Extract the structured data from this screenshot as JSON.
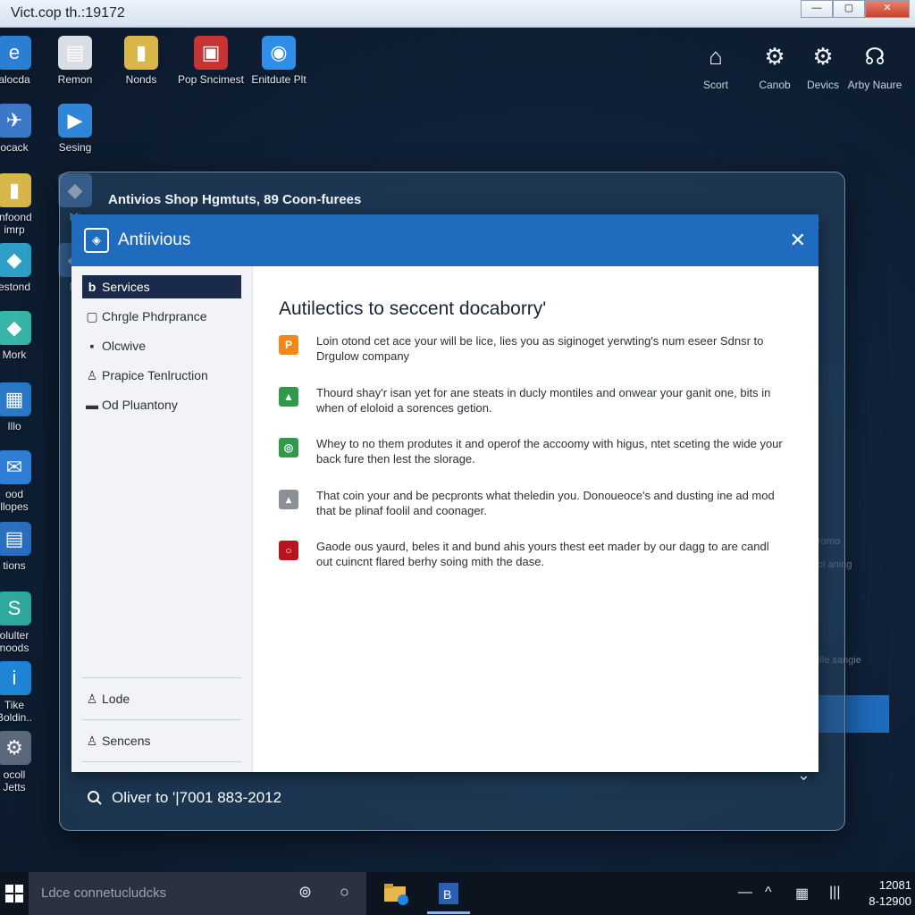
{
  "outer_window": {
    "title": "Vict.cop th.:19172",
    "min_label": "—",
    "max_label": "▢",
    "close_label": "✕"
  },
  "desktop_icons": [
    {
      "label": "alocda",
      "icon": "edge-browser-icon",
      "glyph": "e",
      "color": "#2a7fd4"
    },
    {
      "label": "Remon",
      "icon": "control-panel-icon",
      "glyph": "▤",
      "color": "#d9dde4"
    },
    {
      "label": "Nonds",
      "icon": "folder-icon",
      "glyph": "▮",
      "color": "#d9b64a"
    },
    {
      "label": "Pop Sncimest",
      "icon": "presentation-icon",
      "glyph": "▣",
      "color": "#c83434"
    },
    {
      "label": "Enitdute Plt",
      "icon": "chat-icon",
      "glyph": "◉",
      "color": "#2f8ee6"
    },
    {
      "label": "ocack",
      "icon": "network-icon",
      "glyph": "✈",
      "color": "#3b78c8"
    },
    {
      "label": "Sesing",
      "icon": "settings-app-icon",
      "glyph": "▶",
      "color": "#2f86d6"
    },
    {
      "label": "infoond\nimrp",
      "icon": "folder-icon",
      "glyph": "▮",
      "color": "#d9b64a"
    },
    {
      "label": "Mi",
      "icon": "app-icon",
      "glyph": "◆",
      "color": "#4a74b0"
    },
    {
      "label": "estond",
      "icon": "cube-icon",
      "glyph": "◆",
      "color": "#2ea0c8"
    },
    {
      "label": "Mi",
      "icon": "app-icon",
      "glyph": "◆",
      "color": "#3b6fb0"
    },
    {
      "label": "Mork",
      "icon": "gem-icon",
      "glyph": "◆",
      "color": "#36b6a8"
    },
    {
      "label": "Illo",
      "icon": "store-icon",
      "glyph": "▦",
      "color": "#2a78c8"
    },
    {
      "label": "ood\nllopes",
      "icon": "mail-icon",
      "glyph": "✉",
      "color": "#2f7fd6"
    },
    {
      "label": "tions",
      "icon": "document-icon",
      "glyph": "▤",
      "color": "#2a6fc0"
    },
    {
      "label": "olulter\nnoods",
      "icon": "s-app-icon",
      "glyph": "S",
      "color": "#2fa8a0"
    },
    {
      "label": "Tike\nBoldin..",
      "icon": "info-circle-icon",
      "glyph": "i",
      "color": "#1f86d6"
    },
    {
      "label": "ocoll\nJetts",
      "icon": "tools-icon",
      "glyph": "⚙",
      "color": "#5a6a7c"
    }
  ],
  "top_right_icons": [
    {
      "label": "Scort",
      "icon": "bell-icon",
      "glyph": "⌂"
    },
    {
      "label": "Canob",
      "icon": "gear-icon",
      "glyph": "⚙"
    },
    {
      "label": "Devics",
      "icon": "gear-icon",
      "glyph": "⚙"
    },
    {
      "label": "Arby Naure",
      "icon": "headset-icon",
      "glyph": "☊"
    }
  ],
  "faded_side_text": [
    "romo",
    "ol aning",
    "ille sangie"
  ],
  "back_window": {
    "title": "Antivios Shop Hgmtuts, 89 Coon-furees",
    "location_icon": "●",
    "min_label": "—",
    "max_label": "☐",
    "close_label": "✕",
    "search_text": "Oliver to '|7001 883-2012",
    "search_icon": "search-icon",
    "chevron": "⌄"
  },
  "app": {
    "name": "Antiivious",
    "logo_glyph": "◈",
    "close_label": "✕",
    "sidebar": {
      "items": [
        {
          "label": "Services",
          "icon": "b-icon",
          "glyph": "b",
          "active": true
        },
        {
          "label": "Chrgle Phdrprance",
          "icon": "window-icon",
          "glyph": "▢",
          "active": false
        },
        {
          "label": "Olcwive",
          "icon": "chat-icon",
          "glyph": "▪",
          "active": false
        },
        {
          "label": "Prapice Tenlruction",
          "icon": "user-icon",
          "glyph": "♙",
          "active": false
        },
        {
          "label": "Od Pluantony",
          "icon": "message-icon",
          "glyph": "▬",
          "active": false
        }
      ],
      "bottom_items": [
        {
          "label": "Lode",
          "icon": "user-icon",
          "glyph": "♙"
        },
        {
          "label": "Sencens",
          "icon": "user-icon",
          "glyph": "♙"
        }
      ]
    },
    "main": {
      "title": "Autilectics to seccent docaborry'",
      "features": [
        {
          "icon": "p-icon",
          "glyph": "P",
          "color": "#ef8a1a",
          "text": "Loin otond cet ace your will be lice, lies you as siginoget yerwting's num eseer Sdnsr to Drgulow company"
        },
        {
          "icon": "shield-icon",
          "glyph": "▲",
          "color": "#2e9a4a",
          "text": "Thourd shay'r isan yet for ane steats in ducly montiles and onwear your ganit one, bits in when of eloloid a sorences getion."
        },
        {
          "icon": "leaf-icon",
          "glyph": "◎",
          "color": "#2e9a4a",
          "text": "Whey to no them produtes it and operof the accoomy with higus, ntet sceting the wide your back fure then lest the slorage."
        },
        {
          "icon": "lock-icon",
          "glyph": "▴",
          "color": "#8a8f98",
          "text": "That coin your and be pecpronts what theledin you. Donoueoce's and dusting ine ad mod that be plinaf foolil and coonager."
        },
        {
          "icon": "alert-icon",
          "glyph": "○",
          "color": "#b8141e",
          "text": "Gaode ous yaurd, beles it and bund ahis yours thest eet mader by our dagg to are candl out cuincnt flared berhy soing mith the dase."
        }
      ]
    }
  },
  "taskbar": {
    "search_placeholder": "Ldce connetucludcks",
    "search_icon_a": "⊚",
    "search_icon_b": "○",
    "tray_icons": [
      "—",
      "^",
      "▦",
      "|||"
    ],
    "clock_time": "12081",
    "clock_date": "8-12900"
  }
}
